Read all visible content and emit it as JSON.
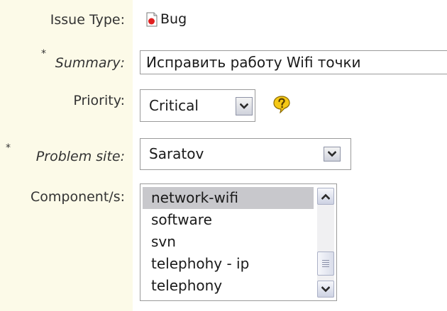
{
  "form": {
    "issue_type": {
      "label": "Issue Type:",
      "value": "Bug",
      "icon": "bug-icon"
    },
    "summary": {
      "required_marker": "*",
      "label": "Summary:",
      "value": "Исправить работу Wifi точки"
    },
    "priority": {
      "label": "Priority:",
      "value": "Critical",
      "help_icon": "help-icon"
    },
    "problem_site": {
      "required_marker": "*",
      "label": "Problem site:",
      "value": "Saratov"
    },
    "components": {
      "label": "Component/s:",
      "items": [
        {
          "label": "network-wifi",
          "selected": true
        },
        {
          "label": "software",
          "selected": false
        },
        {
          "label": "svn",
          "selected": false
        },
        {
          "label": "telephohy - ip",
          "selected": false
        },
        {
          "label": "telephony",
          "selected": false
        }
      ]
    }
  },
  "colors": {
    "label_column_bg": "#fcfae8",
    "selected_item_bg": "#c8c8cc",
    "bug_icon_red": "#e02020",
    "help_icon_yellow": "#f5c816"
  }
}
